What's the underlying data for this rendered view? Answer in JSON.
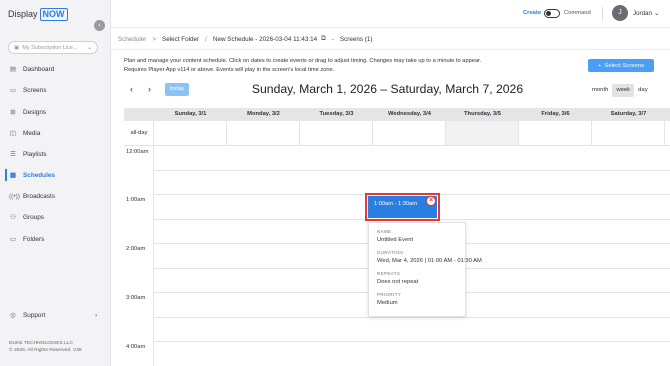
{
  "app": {
    "logo_text": "Display",
    "logo_badge": "NOW"
  },
  "sidebar": {
    "subscription_placeholder": "My Subscription Lice...",
    "items": [
      {
        "label": "Dashboard",
        "icon": "dashboard-icon"
      },
      {
        "label": "Screens",
        "icon": "screens-icon"
      },
      {
        "label": "Designs",
        "icon": "designs-icon"
      },
      {
        "label": "Media",
        "icon": "media-icon"
      },
      {
        "label": "Playlists",
        "icon": "playlists-icon"
      },
      {
        "label": "Schedules",
        "icon": "schedules-icon",
        "active": true
      },
      {
        "label": "Broadcasts",
        "icon": "broadcasts-icon"
      },
      {
        "label": "Groups",
        "icon": "groups-icon"
      },
      {
        "label": "Folders",
        "icon": "folders-icon"
      }
    ],
    "support_label": "Support",
    "footer_company": "DUKE TECHNOLOGIES LLC",
    "footer_copyright": "© 2026. All Rights Reserved. V39"
  },
  "topbar": {
    "create_label": "Create",
    "command_label": "Command",
    "user_initial": "J",
    "user_name": "Jordan"
  },
  "breadcrumb": {
    "root": "Scheduler",
    "folder": "Select Folder",
    "schedule": "New Schedule - 2026-03-04 11:43:14",
    "screens": "Screens (1)"
  },
  "info": {
    "line1": "Plan and manage your content schedule. Click on dates to create events or drag to adjust timing. Changes may take up to a minute to appear.",
    "line2": "Requires Player App v114 or above. Events will play in the screen's local time zone."
  },
  "select_screens_label": "Select Screens",
  "calendar": {
    "today_label": "today",
    "title": "Sunday, March 1, 2026 – Saturday, March 7, 2026",
    "views": [
      "month",
      "week",
      "day"
    ],
    "selected_view": "week",
    "days": [
      "Sunday, 3/1",
      "Monday, 3/2",
      "Tuesday, 3/3",
      "Wednesday, 3/4",
      "Thursday, 3/5",
      "Friday, 3/6",
      "Saturday, 3/7"
    ],
    "allday_label": "all-day",
    "times": [
      "12:00am",
      "1:00am",
      "2:00am",
      "3:00am",
      "4:00am"
    ]
  },
  "event": {
    "time_label": "1:00am - 1:30am",
    "color": "#2a7de1",
    "highlight_color": "#e53935"
  },
  "popover": {
    "name_label": "NAME",
    "name_value": "Untitled Event",
    "duration_label": "DURATION",
    "duration_value": "Wed, Mar 4, 2026 | 01:00 AM - 01:30 AM",
    "repeats_label": "REPEATS",
    "repeats_value": "Does not repeat",
    "priority_label": "PRIORITY",
    "priority_value": "Medium"
  }
}
